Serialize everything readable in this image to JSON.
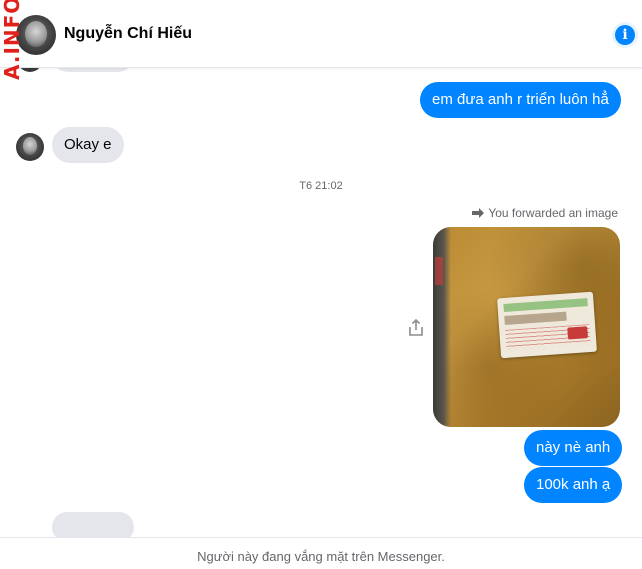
{
  "header": {
    "contact_name": "Nguyễn Chí Hiếu",
    "info_icon": "info-icon"
  },
  "watermark": "A.INFO",
  "messages": {
    "out_1": "em đưa anh r triển luôn hẳ",
    "in_1": "Okay e",
    "timestamp": "T6 21:02",
    "forwarded_label": "You forwarded an image",
    "out_2": "này nè anh",
    "out_3": "100k anh ạ"
  },
  "footer": {
    "status": "Người này đang vắng mặt trên Messenger."
  },
  "colors": {
    "outgoing_bubble": "#0084ff",
    "incoming_bubble": "#e4e6eb",
    "secondary_text": "#65676b"
  }
}
